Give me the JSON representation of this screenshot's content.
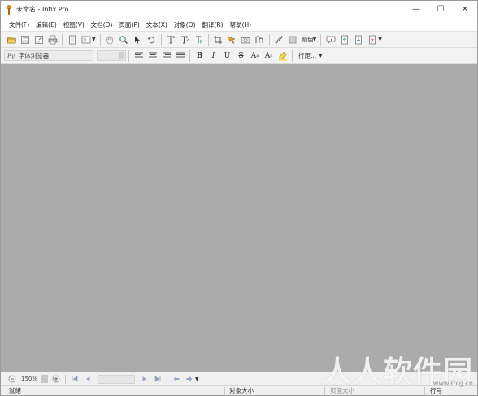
{
  "window": {
    "title": "未命名 - Infix Pro",
    "controls": {
      "minimize": "—",
      "maximize": "☐",
      "close": "✕"
    }
  },
  "menu": [
    {
      "label": "文件(F)"
    },
    {
      "label": "编辑(E)"
    },
    {
      "label": "视图(V)"
    },
    {
      "label": "文档(D)"
    },
    {
      "label": "页面(P)"
    },
    {
      "label": "文本(X)"
    },
    {
      "label": "对象(O)"
    },
    {
      "label": "翻译(R)"
    },
    {
      "label": "帮助(H)"
    }
  ],
  "toolbar1": {
    "color_label": "颜色"
  },
  "toolbar2": {
    "font_prefix": "Fy",
    "font_placeholder": "字体浏览器",
    "bold": "B",
    "italic": "I",
    "underline": "U",
    "strike": "S",
    "superscript": "A",
    "subscript": "A",
    "line_spacing": "行距..."
  },
  "navbar": {
    "zoom_level": "150%"
  },
  "statusbar": {
    "ready": "就绪",
    "object_size": "对象大小",
    "page_size": "页面大小",
    "line_number": "行号"
  },
  "watermark": {
    "text": "人人软件园",
    "url": "www.rrcg.cn"
  },
  "colors": {
    "workspace": "#ababab",
    "toolbar_bg": "#f3f3f3",
    "accent_orange": "#d88a1c"
  }
}
